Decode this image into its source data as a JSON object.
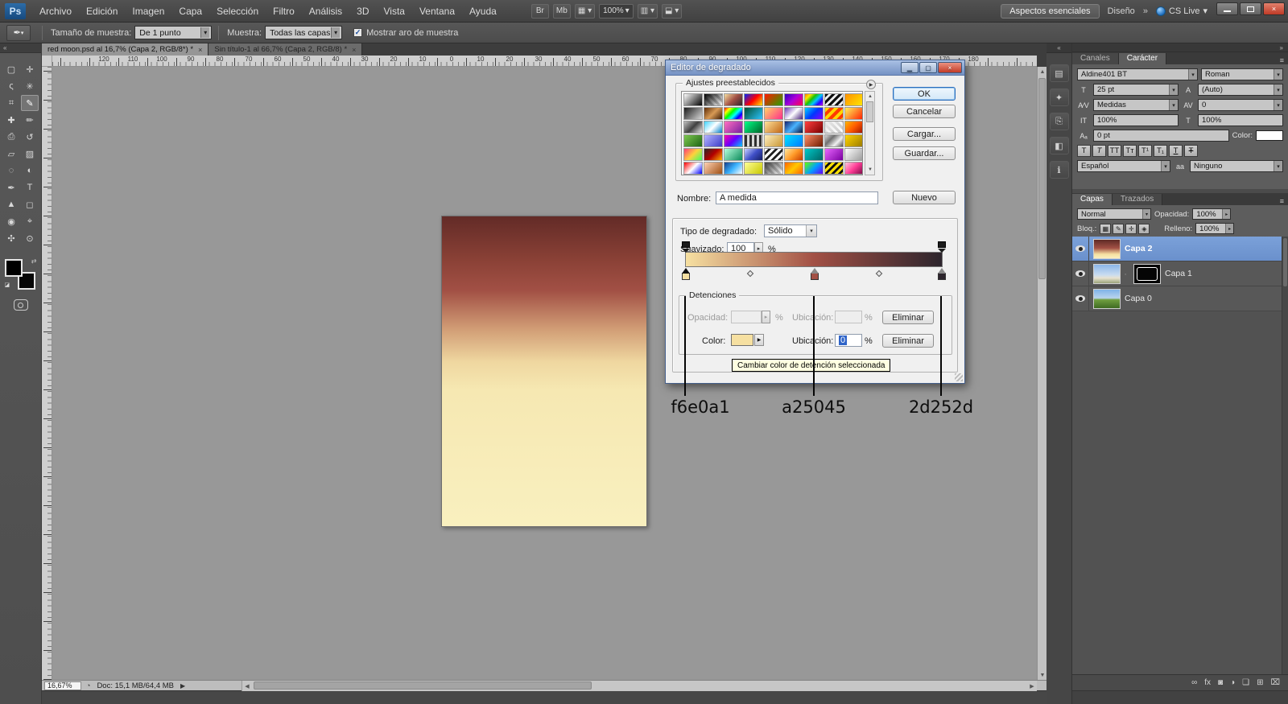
{
  "glyphs": {
    "close": "×",
    "dropdown": "▾",
    "spin": "▸",
    "menu": "≡",
    "collapse_left": "«",
    "collapse_right": "»",
    "tri_right": "▶",
    "tri_left": "◀",
    "tri_up": "▲",
    "tri_down": "▼",
    "check": "✓",
    "swap": "⇄",
    "mini_default": "◪",
    "status_icon": "◔"
  },
  "menubar": {
    "logo": "Ps",
    "items": [
      "Archivo",
      "Edición",
      "Imagen",
      "Capa",
      "Selección",
      "Filtro",
      "Análisis",
      "3D",
      "Vista",
      "Ventana",
      "Ayuda"
    ],
    "bridge_btn": "Br",
    "minibridge_btn": "Mb",
    "view_extras_icon": "▦",
    "zoom_value": "100%",
    "arrange_icon": "▥",
    "screen_mode_icon": "⬓",
    "workspace_active": "Aspectos esenciales",
    "workspace_secondary": "Diseño",
    "workspace_more": "»",
    "cslive_label": "CS Live"
  },
  "optionsbar": {
    "tool_icon": "✒",
    "sample_size_label": "Tamaño de muestra:",
    "sample_size_value": "De 1 punto",
    "sample_label": "Muestra:",
    "sample_value": "Todas las capas",
    "show_ring_label": "Mostrar aro de muestra",
    "show_ring_checked": "✓"
  },
  "toolbar": {
    "tools": [
      {
        "name": "rectangular-marquee-tool",
        "glyph": "▢"
      },
      {
        "name": "move-tool",
        "glyph": "✛"
      },
      {
        "name": "lasso-tool",
        "glyph": "ς"
      },
      {
        "name": "quick-selection-tool",
        "glyph": "✳"
      },
      {
        "name": "crop-tool",
        "glyph": "⌗"
      },
      {
        "name": "eyedropper-tool",
        "glyph": "✎",
        "selected": true
      },
      {
        "name": "healing-brush-tool",
        "glyph": "✚"
      },
      {
        "name": "brush-tool",
        "glyph": "✏"
      },
      {
        "name": "clone-stamp-tool",
        "glyph": "⎙"
      },
      {
        "name": "history-brush-tool",
        "glyph": "↺"
      },
      {
        "name": "eraser-tool",
        "glyph": "▱"
      },
      {
        "name": "gradient-tool",
        "glyph": "▨"
      },
      {
        "name": "blur-tool",
        "glyph": "◌"
      },
      {
        "name": "dodge-tool",
        "glyph": "◐"
      },
      {
        "name": "pen-tool",
        "glyph": "✒"
      },
      {
        "name": "type-tool",
        "glyph": "T"
      },
      {
        "name": "path-selection-tool",
        "glyph": "▲"
      },
      {
        "name": "shape-tool",
        "glyph": "◻"
      },
      {
        "name": "3d-rotate-tool",
        "glyph": "◉"
      },
      {
        "name": "3d-camera-tool",
        "glyph": "⌖"
      },
      {
        "name": "hand-tool",
        "glyph": "✣"
      },
      {
        "name": "zoom-tool",
        "glyph": "⊙"
      }
    ]
  },
  "tabs": [
    {
      "label": "red moon.psd al 16,7% (Capa 2, RGB/8*) *"
    },
    {
      "label": "Sin título-1 al 66,7% (Capa 2, RGB/8) *"
    }
  ],
  "rulers": {
    "horizontal": [
      "120",
      "110",
      "100",
      "90",
      "80",
      "70",
      "60",
      "50",
      "40",
      "30",
      "20",
      "10",
      "0",
      "10",
      "20",
      "30",
      "40",
      "50",
      "60",
      "70",
      "80",
      "90",
      "100",
      "110",
      "120",
      "130",
      "140",
      "150",
      "160",
      "170",
      "180"
    ],
    "vertical": [
      "8",
      "6",
      "4",
      "2",
      "0",
      "2",
      "4",
      "6",
      "8",
      "10",
      "12",
      "14",
      "16",
      "18",
      "20",
      "22",
      "24",
      "26",
      "28",
      "30"
    ]
  },
  "canvas": {
    "style": "background:linear-gradient(180deg,#632b27 0%,#8a4136 14%,#a25045 24%,#d09b74 36%,#efd7a0 47%,#f6e8b2 56%,#f9f0bf 100%)"
  },
  "dialog": {
    "title": "Editor de degradado",
    "presets_group": "Ajustes preestablecidos",
    "ok": "OK",
    "cancel": "Cancelar",
    "load": "Cargar...",
    "save": "Guardar...",
    "name_label": "Nombre:",
    "name_value": "A medida",
    "new_btn": "Nuevo",
    "type_label": "Tipo de degradado:",
    "type_value": "Sólido",
    "smooth_label": "Suavizado:",
    "smooth_value": "100",
    "percent": "%",
    "stops_group": "Detenciones",
    "opacity_label": "Opacidad:",
    "location_label": "Ubicación:",
    "location_value": "0",
    "color_label": "Color:",
    "delete_btn": "Eliminar",
    "tooltip": "Cambiar color de detención seleccionada",
    "bar_style": "background:linear-gradient(90deg,#f6e0a1 0%,#a25045 50%,#2d252d 100%)",
    "stop_styles": [
      "background:#f6e0a1",
      "background:#a25045",
      "background:#2d252d"
    ],
    "swatch_style": "background:#f6e0a1",
    "presets": [
      "linear-gradient(135deg,#ffffff,#000000)",
      "linear-gradient(135deg,#000 0%,rgba(0,0,0,0) 100%),repeating-linear-gradient(45deg,#c8c8c8 0 3px,#ffffff 3px 6px)",
      "linear-gradient(135deg,#f6e0a1,#a25045,#2d252d)",
      "linear-gradient(135deg,#0026ff,#ff0000,#ffe900)",
      "linear-gradient(135deg,#ff1a00,#26a300)",
      "linear-gradient(135deg,#2a00c4,#b000d8,#ff004c)",
      "linear-gradient(135deg,#ff7a00,#ffe400,#19c400,#00c8ff,#2a00ff,#c400ff)",
      "repeating-linear-gradient(135deg,#101010 0 3px,#f0f0f0 3px 6px)",
      "linear-gradient(135deg,#ff9000,#ffe800)",
      "linear-gradient(135deg,#1b1b1b,#d8d8d8)",
      "linear-gradient(135deg,#5c2c08,#d89a55,#3c1c04)",
      "linear-gradient(135deg,#ff0000,#ffff00,#00ff00,#00ffff,#0000ff,#ff00ff)",
      "linear-gradient(135deg,#004f30,#2cc3ff)",
      "linear-gradient(135deg,#ffd266,#ff2d8a)",
      "linear-gradient(135deg,#6a39b8,#ffffff,#45207a)",
      "linear-gradient(135deg,#00d2ff,#0036ff,#8a00ff)",
      "repeating-linear-gradient(135deg,#ffd800 0 4px,#ff3c00 4px 8px)",
      "linear-gradient(135deg,#fff45c,#ff1e00)",
      "linear-gradient(135deg,#c0c0c0,#404040,#e8e8e8)",
      "linear-gradient(135deg,#3cd2ff,#ffffff,#0080c8)",
      "linear-gradient(135deg,#ff6ec0,#7a1fa0)",
      "linear-gradient(135deg,#00ff87,#006428)",
      "linear-gradient(135deg,#ffe29a,#c06514)",
      "linear-gradient(135deg,#14206e,#4ab4ff,#0a1440)",
      "linear-gradient(135deg,#ff4040,#7a0000)",
      "linear-gradient(135deg,#e8e8e8 0%,rgba(255,255,255,0) 100%),repeating-linear-gradient(45deg,#c8c8c8 0 3px,#fff 3px 6px)",
      "linear-gradient(135deg,#ffb400,#ff5a00,#a01400)",
      "linear-gradient(135deg,#7ec850,#1e6414)",
      "linear-gradient(135deg,#b4b4ff,#3c3cc8)",
      "linear-gradient(135deg,#ff00a8,#6400ff,#00c8ff)",
      "repeating-linear-gradient(90deg,#303030 0 3px,#d8d8d8 3px 6px)",
      "linear-gradient(135deg,#ffefc0,#c89632)",
      "linear-gradient(135deg,#00e1ff,#007aff)",
      "linear-gradient(135deg,#ff8a65,#6d1b00)",
      "linear-gradient(135deg,#d8d8d8,#707070,#f0f0f0,#505050)",
      "linear-gradient(135deg,#ffd500,#9a7a00)",
      "linear-gradient(135deg,#ff3c78,#ffd23c,#3cff64)",
      "linear-gradient(135deg,#282828,#b40000,#ffb400)",
      "linear-gradient(135deg,#b4ffdc,#0a8a5a)",
      "linear-gradient(135deg,#c8d2ff,#4050c8,#141e64)",
      "repeating-linear-gradient(135deg,#fff 0 3px,#202020 3px 6px)",
      "linear-gradient(135deg,#ffe8a0,#ff9a28,#c83c00)",
      "linear-gradient(135deg,#00c8c8,#006464)",
      "linear-gradient(135deg,#e864ff,#7a00a0)",
      "linear-gradient(135deg,#ffffff,#9a9a9a)",
      "linear-gradient(135deg,#ff0000,#ffffff,#0000ff)",
      "linear-gradient(135deg,#ffd2b4,#a05014)",
      "linear-gradient(135deg,#143c8a,#3cb4ff,#ffffff)",
      "linear-gradient(135deg,#ffff96,#c8c800)",
      "linear-gradient(135deg,#3c3c3c 0%,rgba(0,0,0,0) 100%),repeating-linear-gradient(45deg,#c8c8c8 0 3px,#fff 3px 6px)",
      "linear-gradient(135deg,#ff6400,#ffc800,#ff6400)",
      "linear-gradient(135deg,#64ff00,#00a0ff,#6400ff)",
      "repeating-linear-gradient(135deg,#ffe000 0 3px,#111 3px 6px)",
      "linear-gradient(135deg,#ffc8dc,#ff3c96,#780a46)"
    ]
  },
  "annotations": [
    {
      "label": "f6e0a1"
    },
    {
      "label": "a25045"
    },
    {
      "label": "2d252d"
    }
  ],
  "collapsed_icons": [
    {
      "name": "collapsed-panel-icon-1",
      "glyph": "▤"
    },
    {
      "name": "collapsed-panel-icon-2",
      "glyph": "✦"
    },
    {
      "name": "collapsed-panel-icon-3",
      "glyph": "⎘"
    },
    {
      "name": "collapsed-panel-icon-4",
      "glyph": "◧"
    },
    {
      "name": "collapsed-panel-icon-5",
      "glyph": "ℹ"
    }
  ],
  "character": {
    "tab_channels": "Canales",
    "tab_character": "Carácter",
    "font_family": "Aldine401 BT",
    "font_style": "Roman",
    "size_value": "25 pt",
    "leading_value": "(Auto)",
    "kerning_value": "Medidas",
    "tracking_value": "0",
    "vscale_value": "100%",
    "hscale_value": "100%",
    "baseline_value": "0 pt",
    "color_label": "Color:",
    "language_value": "Español",
    "antialias_value": "Ninguno",
    "icons": {
      "size": "T",
      "leading": "A",
      "kern": "A⁄V",
      "track": "AV",
      "vscale": "IT",
      "hscale": "T",
      "baseline": "Aₐ",
      "aa": "aa"
    },
    "style_buttons": [
      {
        "name": "faux-bold-icon",
        "glyph": "T",
        "css": ""
      },
      {
        "name": "faux-italic-icon",
        "glyph": "T",
        "css": "italic"
      },
      {
        "name": "all-caps-icon",
        "glyph": "TT",
        "css": ""
      },
      {
        "name": "small-caps-icon",
        "glyph": "Tᴛ",
        "css": ""
      },
      {
        "name": "superscript-icon",
        "glyph": "T¹",
        "css": ""
      },
      {
        "name": "subscript-icon",
        "glyph": "T₁",
        "css": ""
      },
      {
        "name": "underline-icon",
        "glyph": "T",
        "css": "under"
      },
      {
        "name": "strikethrough-icon",
        "glyph": "Ŧ",
        "css": "strike"
      }
    ]
  },
  "layers": {
    "tab_layers": "Capas",
    "tab_paths": "Trazados",
    "blend_value": "Normal",
    "opacity_label": "Opacidad:",
    "opacity_value": "100%",
    "lock_label": "Bloq.:",
    "fill_label": "Relleno:",
    "fill_value": "100%",
    "lock_icons": [
      {
        "name": "lock-transparency-icon",
        "glyph": "▦"
      },
      {
        "name": "lock-pixels-icon",
        "glyph": "✎"
      },
      {
        "name": "lock-position-icon",
        "glyph": "✛"
      },
      {
        "name": "lock-all-icon",
        "glyph": "◈"
      }
    ],
    "items": [
      {
        "name": "Capa 2",
        "selected": true,
        "thumb": "linear-gradient(180deg,#5e2a26,#a25045 45%,#f6e0a1 78%,#f9f0bf)"
      },
      {
        "name": "Capa 1",
        "selected": false,
        "thumb": "linear-gradient(180deg,#8ab6e8 0%,#c9dcf0 55%,#e8e2d0 72%,#9aa37a 100%)",
        "mask": "#050505"
      },
      {
        "name": "Capa 0",
        "selected": false,
        "thumb": "linear-gradient(180deg,#7fb3e8 0%,#b8d4ee 45%,#6f9e3f 55%,#3f6b22 100%)"
      }
    ],
    "bottom_icons": [
      {
        "name": "link-layers-icon",
        "glyph": "∞"
      },
      {
        "name": "layer-style-icon",
        "glyph": "fx"
      },
      {
        "name": "layer-mask-icon",
        "glyph": "◙"
      },
      {
        "name": "adjustment-layer-icon",
        "glyph": "◑"
      },
      {
        "name": "layer-group-icon",
        "glyph": "❏"
      },
      {
        "name": "new-layer-icon",
        "glyph": "⊞"
      },
      {
        "name": "delete-layer-icon",
        "glyph": "⌧"
      }
    ]
  },
  "statusbar": {
    "zoom": "16,67%",
    "doc": "Doc: 15,1 MB/64,4 MB"
  }
}
